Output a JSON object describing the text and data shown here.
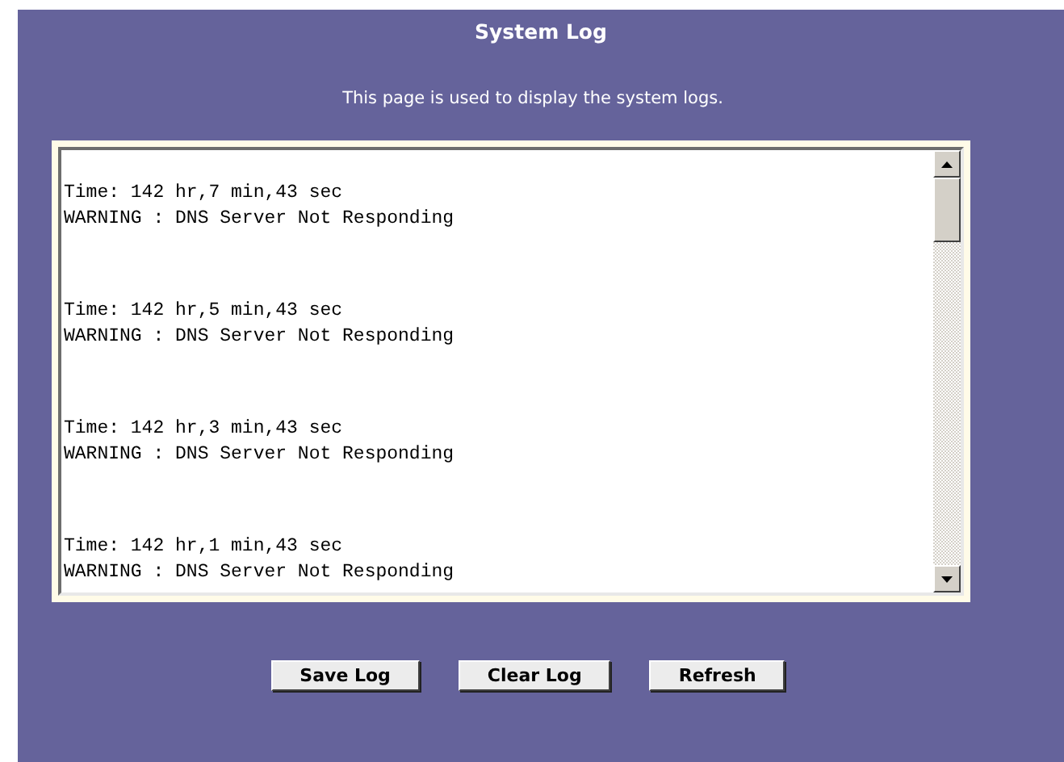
{
  "title": "System Log",
  "description": "This page is used to display the system logs.",
  "log_entries": [
    {
      "time": "Time: 142 hr,7 min,43 sec",
      "message": "WARNING : DNS Server Not Responding"
    },
    {
      "time": "Time: 142 hr,5 min,43 sec",
      "message": "WARNING : DNS Server Not Responding"
    },
    {
      "time": "Time: 142 hr,3 min,43 sec",
      "message": "WARNING : DNS Server Not Responding"
    },
    {
      "time": "Time: 142 hr,1 min,43 sec",
      "message": "WARNING : DNS Server Not Responding"
    }
  ],
  "buttons": [
    "Save Log",
    "Clear Log",
    "Refresh"
  ]
}
